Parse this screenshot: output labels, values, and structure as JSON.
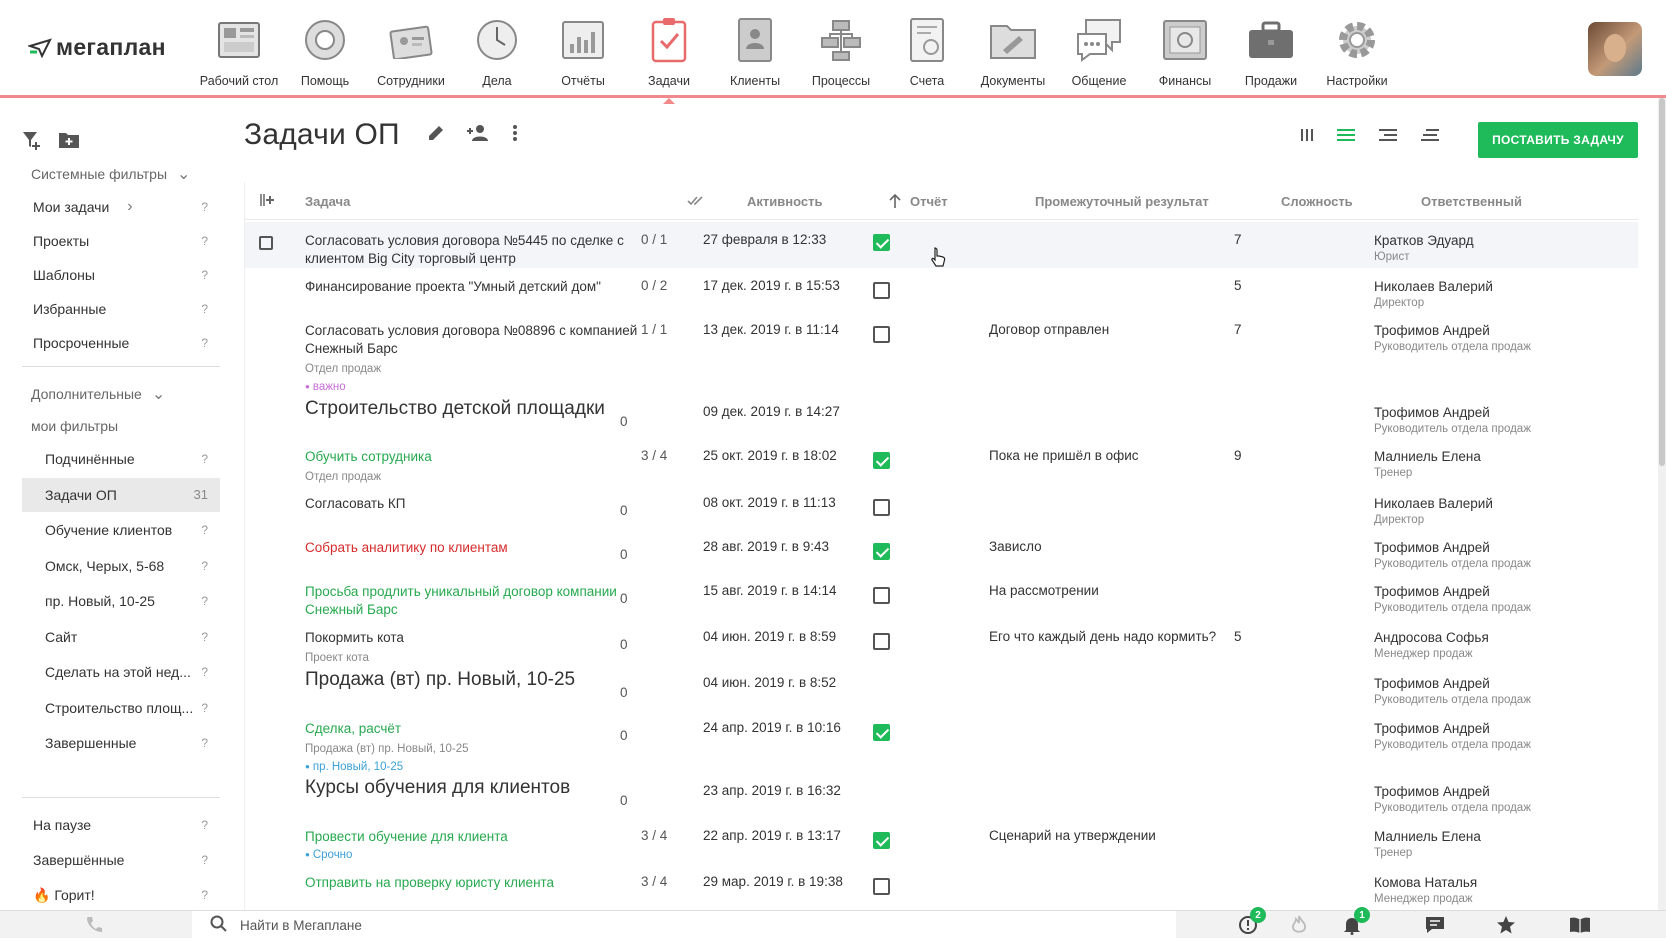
{
  "app": {
    "logo_text": "мегаплан",
    "modules": [
      {
        "label": "Рабочий стол",
        "icon": "desktop-icon"
      },
      {
        "label": "Помощь",
        "icon": "lifebuoy-icon"
      },
      {
        "label": "Сотрудники",
        "icon": "employees-icon"
      },
      {
        "label": "Дела",
        "icon": "clock-icon"
      },
      {
        "label": "Отчёты",
        "icon": "reports-icon"
      },
      {
        "label": "Задачи",
        "icon": "tasks-icon",
        "active": true
      },
      {
        "label": "Клиенты",
        "icon": "clients-icon"
      },
      {
        "label": "Процессы",
        "icon": "processes-icon"
      },
      {
        "label": "Счета",
        "icon": "invoices-icon"
      },
      {
        "label": "Документы",
        "icon": "documents-icon"
      },
      {
        "label": "Общение",
        "icon": "chat-icon"
      },
      {
        "label": "Финансы",
        "icon": "safe-icon"
      },
      {
        "label": "Продажи",
        "icon": "briefcase-icon"
      },
      {
        "label": "Настройки",
        "icon": "gear-icon"
      }
    ]
  },
  "sidebar": {
    "system_filters": "Системные фильтры",
    "items_top": [
      {
        "label": "Мои задачи",
        "q": "?"
      },
      {
        "label": "Проекты",
        "q": "?"
      },
      {
        "label": "Шаблоны",
        "q": "?"
      },
      {
        "label": "Избранные",
        "q": "?"
      },
      {
        "label": "Просроченные",
        "q": "?"
      }
    ],
    "additional": "Дополнительные",
    "my_filters": "мои фильтры",
    "items_sub": [
      {
        "label": "Подчинённые",
        "q": "?"
      },
      {
        "label": "Задачи ОП",
        "q": "31",
        "active": true
      },
      {
        "label": "Обучение клиентов",
        "q": "?"
      },
      {
        "label": "Омск, Черых, 5-68",
        "q": "?"
      },
      {
        "label": "пр. Новый, 10-25",
        "q": "?"
      },
      {
        "label": "Сайт",
        "q": "?"
      },
      {
        "label": "Сделать на этой нед...",
        "q": "?"
      },
      {
        "label": "Строительство площ...",
        "q": "?"
      },
      {
        "label": "Завершенные",
        "q": "?"
      }
    ],
    "items_bottom": [
      {
        "label": "На паузе",
        "q": "?"
      },
      {
        "label": "Завершённые",
        "q": "?"
      },
      {
        "label": "🔥 Горит!",
        "q": "?"
      }
    ]
  },
  "main": {
    "title": "Задачи ОП",
    "add_button": "ПОСТАВИТЬ ЗАДАЧУ"
  },
  "table": {
    "columns": {
      "task": "Задача",
      "activity": "Активность",
      "report": "Отчёт",
      "interm": "Промежуточный результат",
      "complexity": "Сложность",
      "responsible": "Ответственный"
    },
    "rows": [
      {
        "task": "Согласовать условия договора №5445 по сделке с клиентом Big City торговый центр",
        "progress": "0 / 1",
        "activity": "27 февраля в 12:33",
        "report": true,
        "interm": "",
        "complexity": "7",
        "resp": "Кратков Эдуард",
        "role": "Юрист"
      },
      {
        "task": "Финансирование проекта \"Умный детский дом\"",
        "progress": "0 / 2",
        "activity": "17 дек. 2019 г. в 15:53",
        "report": false,
        "interm": "",
        "complexity": "5",
        "resp": "Николаев Валерий",
        "role": "Директор"
      },
      {
        "task": "Согласовать условия договора №08896 с компанией Снежный Барс",
        "sub": "Отдел продаж",
        "tag": "важно",
        "progress": "1 / 1",
        "activity": "13 дек. 2019 г. в 11:14",
        "report": false,
        "interm": "Договор отправлен",
        "complexity": "7",
        "resp": "Трофимов Андрей",
        "role": "Руководитель отдела продаж"
      },
      {
        "task": "Строительство детской площадки",
        "progress": "0",
        "activity": "09 дек. 2019 г. в 14:27",
        "resp": "Трофимов Андрей",
        "role": "Руководитель отдела продаж"
      },
      {
        "task": "Обучить сотрудника",
        "sub": "Отдел продаж",
        "progress": "3 / 4",
        "activity": "25 окт. 2019 г. в 18:02",
        "report": true,
        "interm": "Пока не пришёл в офис",
        "complexity": "9",
        "resp": "Малниель Елена",
        "role": "Тренер"
      },
      {
        "task": "Согласовать КП",
        "progress": "0",
        "activity": "08 окт. 2019 г. в 11:13",
        "report": false,
        "resp": "Николаев Валерий",
        "role": "Директор"
      },
      {
        "task": "Собрать аналитику по клиентам",
        "progress": "0",
        "activity": "28 авг. 2019 г. в 9:43",
        "report": true,
        "interm": "Зависло",
        "resp": "Трофимов Андрей",
        "role": "Руководитель отдела продаж"
      },
      {
        "task": "Просьба продлить уникальный договор компании Снежный Барс",
        "progress": "0",
        "activity": "15 авг. 2019 г. в 14:14",
        "report": false,
        "interm": "На рассмотрении",
        "resp": "Трофимов Андрей",
        "role": "Руководитель отдела продаж"
      },
      {
        "task": "Покормить кота",
        "sub": "Проект кота",
        "progress": "0",
        "activity": "04 июн. 2019 г. в 8:59",
        "report": false,
        "interm": "Его что каждый день надо кормить?",
        "complexity": "5",
        "resp": "Андросова Софья",
        "role": "Менеджер продаж"
      },
      {
        "task": "Продажа (вт) пр. Новый, 10-25",
        "progress": "0",
        "activity": "04 июн. 2019 г. в 8:52",
        "resp": "Трофимов Андрей",
        "role": "Руководитель отдела продаж"
      },
      {
        "task": "Сделка, расчёт",
        "sub": "Продажа (вт) пр. Новый, 10-25",
        "tag": "пр. Новый, 10-25",
        "progress": "0",
        "activity": "24 апр. 2019 г. в 10:16",
        "report": true,
        "resp": "Трофимов Андрей",
        "role": "Руководитель отдела продаж"
      },
      {
        "task": "Курсы обучения для клиентов",
        "progress": "0",
        "activity": "23 апр. 2019 г. в 16:32",
        "resp": "Трофимов Андрей",
        "role": "Руководитель отдела продаж"
      },
      {
        "task": "Провести обучение для клиента",
        "tag": "Срочно",
        "progress": "3 / 4",
        "activity": "22 апр. 2019 г. в 13:17",
        "report": true,
        "interm": "Сценарий на утверждении",
        "resp": "Малниель Елена",
        "role": "Тренер"
      },
      {
        "task": "Отправить на проверку юристу клиента",
        "progress": "3 / 4",
        "activity": "29 мар. 2019 г. в 19:38",
        "report": false,
        "resp": "Комова Наталья",
        "role": "Менеджер продаж"
      }
    ]
  },
  "bottom": {
    "search_placeholder": "Найти в Мегаплане",
    "badge_alerts": "2",
    "badge_notifications": "1"
  },
  "colors": {
    "accent_green": "#1fba5a",
    "topbar_line": "#f08a8a",
    "tag_important": "#c86dd7",
    "tag_blue": "#3aa0d8"
  }
}
